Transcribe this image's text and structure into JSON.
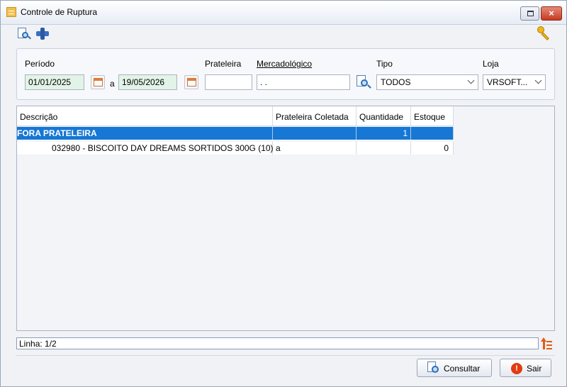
{
  "window": {
    "title": "Controle de Ruptura",
    "restore_glyph": "",
    "close_glyph": "×"
  },
  "filters": {
    "periodo_label": "Período",
    "date_from": "01/01/2025",
    "date_sep": "a",
    "date_to": "19/05/2026",
    "prateleira_label": "Prateleira",
    "prateleira_value": "",
    "mercadologico_label": "Mercadológico",
    "mercadologico_value": ". .",
    "tipo_label": "Tipo",
    "tipo_value": "TODOS",
    "loja_label": "Loja",
    "loja_value": "VRSOFT..."
  },
  "grid": {
    "columns": [
      "Descrição",
      "Prateleira Coletada",
      "Quantidade",
      "Estoque"
    ],
    "rows": [
      {
        "descricao": "FORA PRATELEIRA",
        "prateleira": "",
        "quantidade": "1",
        "estoque": ""
      },
      {
        "descricao": "032980 - BISCOITO DAY DREAMS SORTIDOS 300G (10)",
        "prateleira": "a",
        "quantidade": "",
        "estoque": "0"
      }
    ]
  },
  "status": {
    "linha": "Linha: 1/2"
  },
  "buttons": {
    "consultar": "Consultar",
    "sair": "Sair",
    "sair_glyph": "!"
  },
  "colors": {
    "selection": "#1677d4",
    "date_field": "#e2f4e7",
    "accent_orange": "#e55a12"
  }
}
